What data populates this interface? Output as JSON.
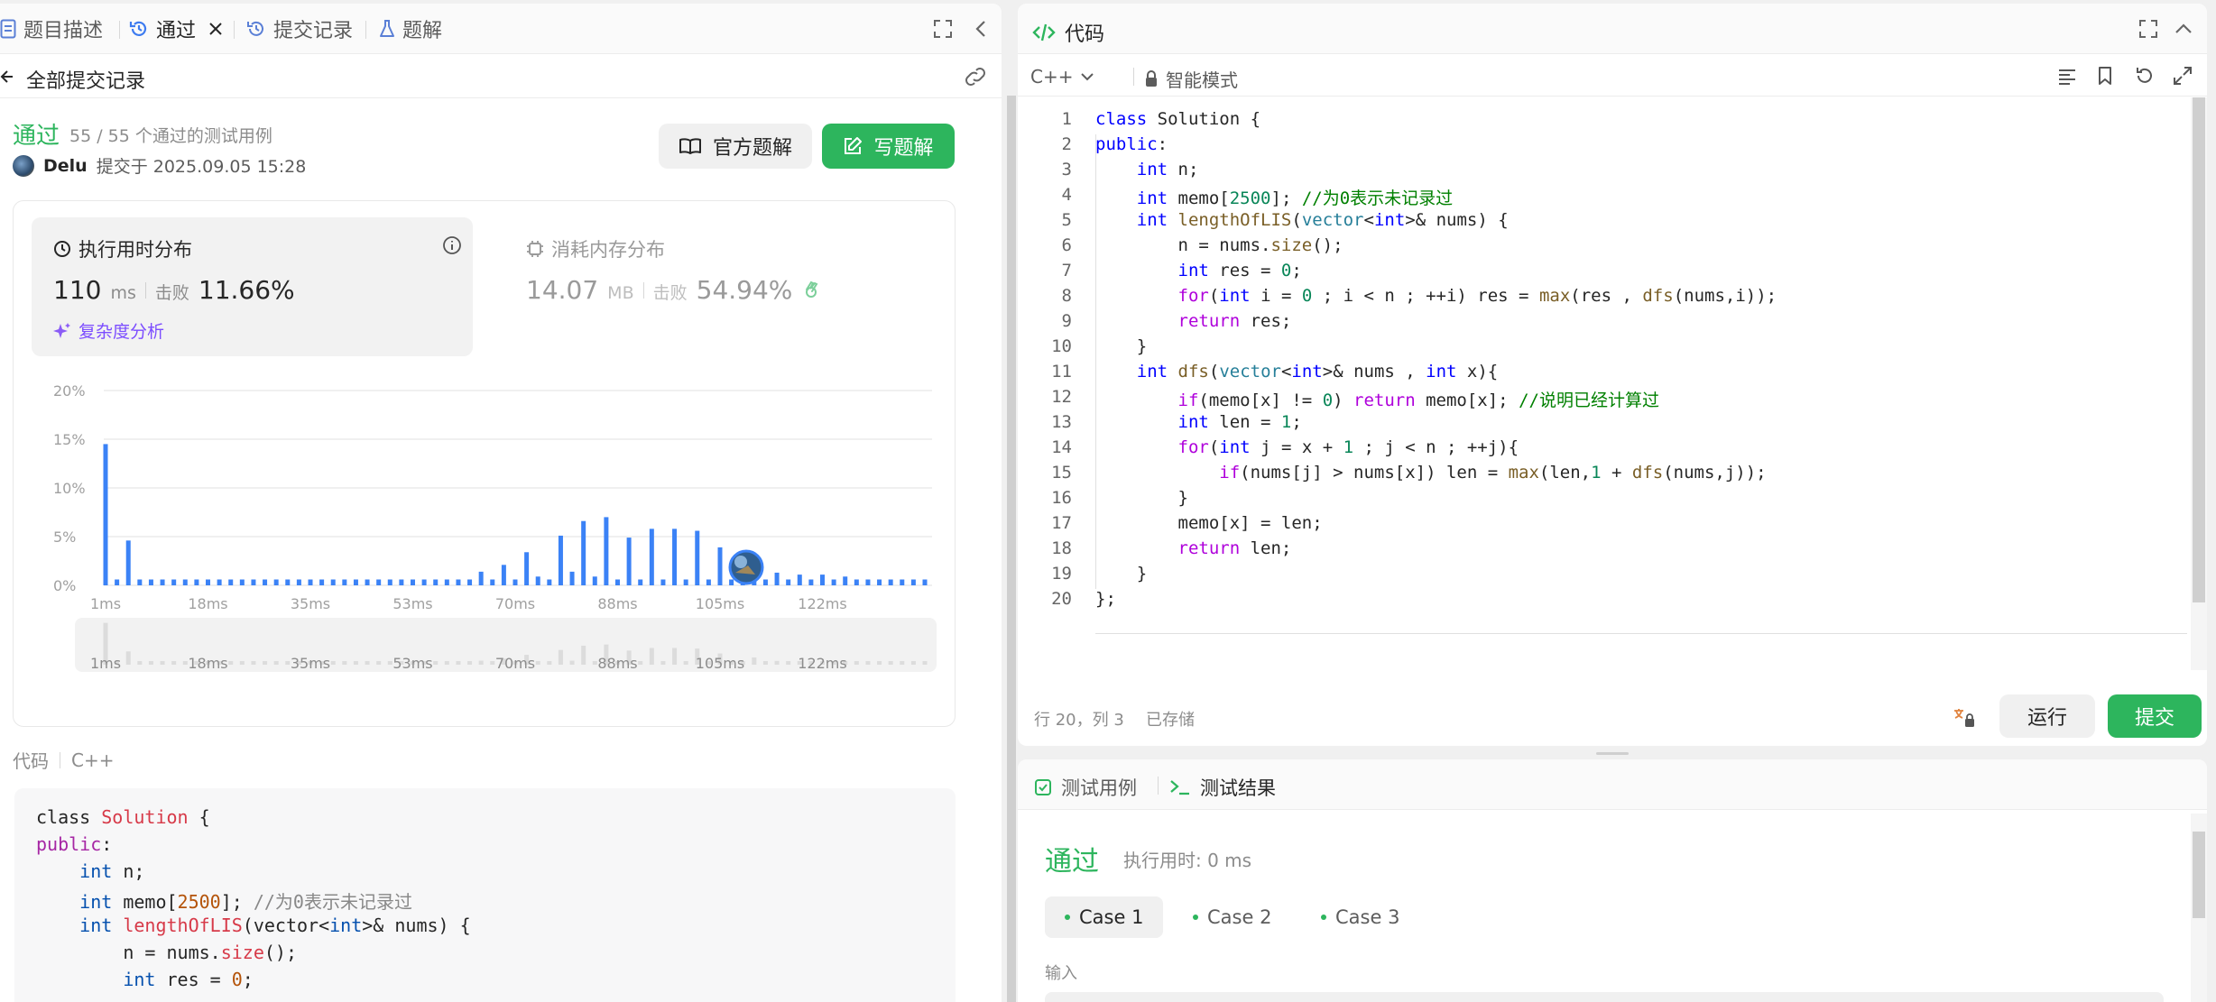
{
  "tabs": [
    {
      "label": "题目描述"
    },
    {
      "label": "通过"
    },
    {
      "label": "提交记录"
    },
    {
      "label": "题解"
    }
  ],
  "submission": {
    "back_label": "全部提交记录",
    "status": "通过",
    "testcases": "55 / 55 个通过的测试用例",
    "user": "Delu",
    "submitted_at": "提交于 2025.09.05 15:28",
    "official_solution": "官方题解",
    "write_solution": "写题解"
  },
  "runtime": {
    "title": "执行用时分布",
    "value": "110",
    "unit": "ms",
    "beats_label": "击败",
    "beats": "11.66%",
    "complexity": "复杂度分析"
  },
  "memory": {
    "title": "消耗内存分布",
    "value": "14.07",
    "unit": "MB",
    "beats_label": "击败",
    "beats": "54.94%"
  },
  "chart_data": {
    "type": "bar",
    "categories": [
      "1ms",
      "3ms",
      "5ms",
      "7ms",
      "9ms",
      "11ms",
      "13ms",
      "15ms",
      "17ms",
      "18ms",
      "20ms",
      "22ms",
      "24ms",
      "26ms",
      "28ms",
      "30ms",
      "32ms",
      "34ms",
      "35ms",
      "37ms",
      "39ms",
      "41ms",
      "43ms",
      "45ms",
      "47ms",
      "49ms",
      "51ms",
      "53ms",
      "55ms",
      "57ms",
      "59ms",
      "61ms",
      "63ms",
      "65ms",
      "67ms",
      "69ms",
      "70ms",
      "72ms",
      "74ms",
      "76ms",
      "78ms",
      "80ms",
      "82ms",
      "84ms",
      "86ms",
      "88ms",
      "90ms",
      "92ms",
      "94ms",
      "96ms",
      "98ms",
      "100ms",
      "102ms",
      "104ms",
      "105ms",
      "107ms",
      "109ms",
      "111ms",
      "113ms",
      "115ms",
      "117ms",
      "119ms",
      "121ms",
      "122ms",
      "124ms",
      "126ms",
      "128ms",
      "130ms",
      "132ms",
      "134ms",
      "136ms",
      "138ms",
      "140ms"
    ],
    "values": [
      14.5,
      0.6,
      4.6,
      0.6,
      0.6,
      0.6,
      0.6,
      0.6,
      0.6,
      0.6,
      0.6,
      0.6,
      0.6,
      0.6,
      0.6,
      0.6,
      0.6,
      0.6,
      0.6,
      0.6,
      0.6,
      0.6,
      0.6,
      0.6,
      0.6,
      0.6,
      0.6,
      0.6,
      0.6,
      0.6,
      0.6,
      0.6,
      0.6,
      1.4,
      0.6,
      2.1,
      0.6,
      3.4,
      0.9,
      0.6,
      5.1,
      1.4,
      6.6,
      0.9,
      7.0,
      0.6,
      4.9,
      0.6,
      5.8,
      0.6,
      5.8,
      0.6,
      5.6,
      0.6,
      3.9,
      0.6,
      0.9,
      2.5,
      0.6,
      1.3,
      0.6,
      1.1,
      0.6,
      1.1,
      0.6,
      0.9,
      0.6,
      0.6,
      0.6,
      0.6,
      0.6,
      0.6,
      0.6
    ],
    "x_tick_labels": [
      "1ms",
      "18ms",
      "35ms",
      "53ms",
      "70ms",
      "88ms",
      "105ms",
      "122ms"
    ],
    "y_tick_labels": [
      "20%",
      "15%",
      "10%",
      "5%",
      "0%"
    ],
    "ylim": [
      0,
      20
    ],
    "grid": true,
    "bar_color": "#3b82f6"
  },
  "code_section": {
    "label": "代码",
    "language": "C++"
  },
  "code_lines": [
    "class Solution {",
    "public:",
    "    int n;",
    "    int memo[2500]; //为0表示未记录过",
    "    int lengthOfLIS(vector<int>& nums) {",
    "        n = nums.size();",
    "        int res = 0;",
    "        for(int i = 0 ; i < n ; ++i) res = max(res , dfs(nums,i));",
    "        return res;",
    "    }",
    "    int dfs(vector<int>& nums , int x){",
    "        if(memo[x] != 0) return memo[x]; //说明已经计算过",
    "        int len = 1;",
    "        for(int j = x + 1 ; j < n ; ++j){",
    "            if(nums[j] > nums[x]) len = max(len,1 + dfs(nums,j));",
    "        }",
    "        memo[x] = len;",
    "        return len;",
    "    }",
    "};"
  ],
  "editor": {
    "title": "代码",
    "language": "C++",
    "mode": "智能模式",
    "cursor": "行 20，列 3",
    "saved": "已存储",
    "run": "运行",
    "submit": "提交"
  },
  "results": {
    "tab_cases": "测试用例",
    "tab_result": "测试结果",
    "status": "通过",
    "runtime": "执行用时: 0 ms",
    "cases": [
      "Case 1",
      "Case 2",
      "Case 3"
    ],
    "input_label": "输入"
  },
  "colors": {
    "accent_green": "#2db55d",
    "bar_blue": "#3b82f6",
    "text": "#262626"
  }
}
